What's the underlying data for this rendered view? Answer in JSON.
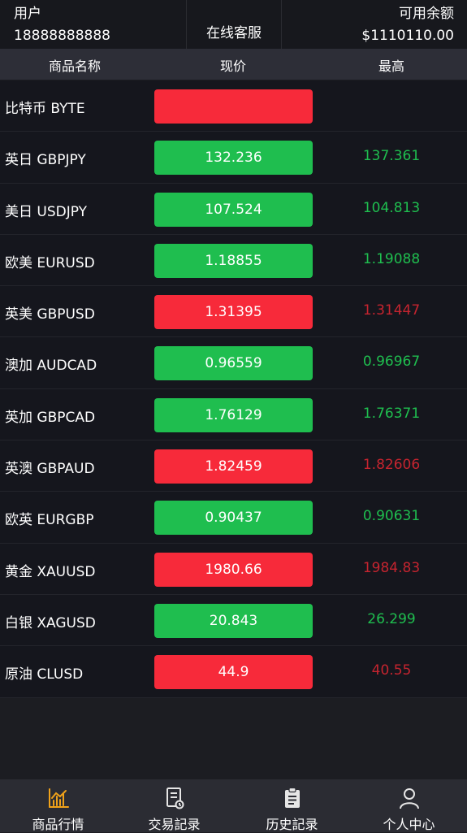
{
  "header": {
    "user_label": "用户",
    "user_id": "18888888888",
    "service": "在线客服",
    "balance_label": "可用余额",
    "balance": "$1110110.00"
  },
  "columns": {
    "name": "商品名称",
    "price": "现价",
    "high": "最高"
  },
  "rows": [
    {
      "name": "比特币 BYTE",
      "price": "",
      "high": "",
      "trend": "down"
    },
    {
      "name": "英日 GBPJPY",
      "price": "132.236",
      "high": "137.361",
      "trend": "up"
    },
    {
      "name": "美日 USDJPY",
      "price": "107.524",
      "high": "104.813",
      "trend": "up"
    },
    {
      "name": "欧美 EURUSD",
      "price": "1.18855",
      "high": "1.19088",
      "trend": "up"
    },
    {
      "name": "英美 GBPUSD",
      "price": "1.31395",
      "high": "1.31447",
      "trend": "down"
    },
    {
      "name": "澳加 AUDCAD",
      "price": "0.96559",
      "high": "0.96967",
      "trend": "up"
    },
    {
      "name": "英加 GBPCAD",
      "price": "1.76129",
      "high": "1.76371",
      "trend": "up"
    },
    {
      "name": "英澳 GBPAUD",
      "price": "1.82459",
      "high": "1.82606",
      "trend": "down"
    },
    {
      "name": "欧英 EURGBP",
      "price": "0.90437",
      "high": "0.90631",
      "trend": "up"
    },
    {
      "name": "黄金 XAUUSD",
      "price": "1980.66",
      "high": "1984.83",
      "trend": "down"
    },
    {
      "name": "白银 XAGUSD",
      "price": "20.843",
      "high": "26.299",
      "trend": "up"
    },
    {
      "name": "原油 CLUSD",
      "price": "44.9",
      "high": "40.55",
      "trend": "down"
    }
  ],
  "tabs": [
    {
      "label": "商品行情",
      "icon": "chart-icon",
      "active": true
    },
    {
      "label": "交易記录",
      "icon": "document-icon",
      "active": false
    },
    {
      "label": "历史記录",
      "icon": "clipboard-icon",
      "active": false
    },
    {
      "label": "个人中心",
      "icon": "user-icon",
      "active": false
    }
  ],
  "colors": {
    "up": "#1fbe4f",
    "down": "#f72a3a",
    "active_tab": "#f0a21a"
  }
}
